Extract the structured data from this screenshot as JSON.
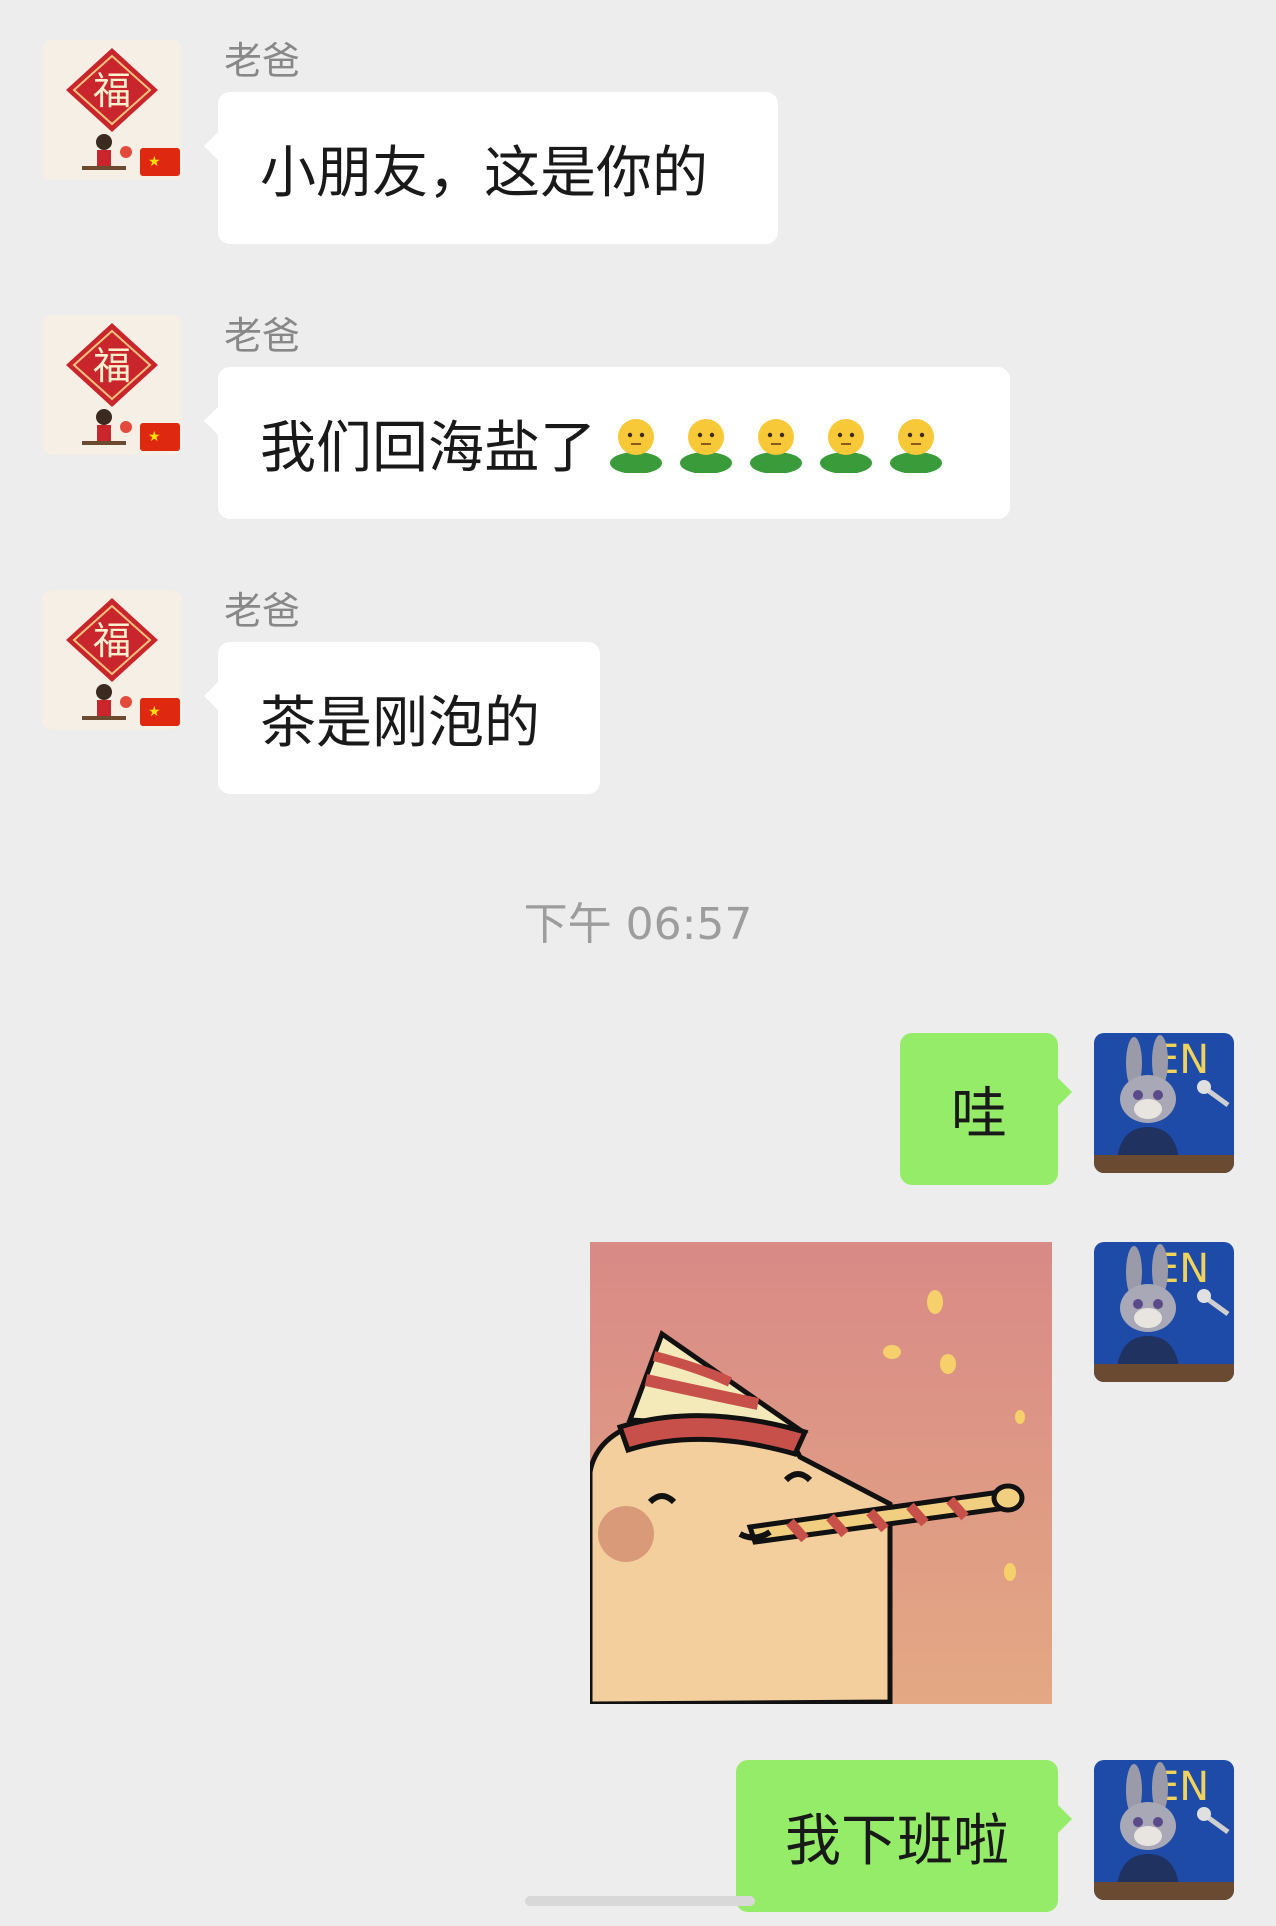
{
  "timestamp": "下午 06:57",
  "incoming": [
    {
      "sender": "老爸",
      "text": "小朋友，这是你的",
      "emoji": "",
      "emoji_count": 0
    },
    {
      "sender": "老爸",
      "text": "我们回海盐了",
      "emoji": "person-in-green-shirt-emoji",
      "emoji_count": 5
    },
    {
      "sender": "老爸",
      "text": "茶是刚泡的",
      "emoji": "",
      "emoji_count": 0
    }
  ],
  "outgoing": [
    {
      "text": "哇"
    },
    {
      "type": "sticker",
      "sticker": "party-bear-sticker"
    },
    {
      "text": "我下班啦"
    }
  ],
  "avatars": {
    "dad": {
      "icon": "fu-new-year-avatar-icon",
      "colors": {
        "diamond": "#c8262c",
        "flag": "#de2910"
      }
    },
    "me": {
      "icon": "rabbit-officer-avatar-icon",
      "colors": {
        "uniform": "#1f3260",
        "background": "#1e4aa8"
      }
    }
  },
  "colors": {
    "background": "#ededed",
    "incoming_bubble": "#ffffff",
    "outgoing_bubble": "#95ec69"
  }
}
